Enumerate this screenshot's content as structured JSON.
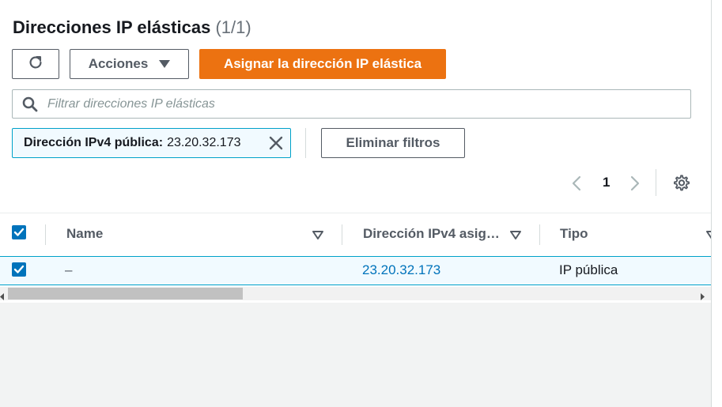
{
  "header": {
    "title": "Direcciones IP elásticas",
    "count": "(1/1)"
  },
  "toolbar": {
    "refresh_icon": "refresh-icon",
    "actions_label": "Acciones",
    "allocate_label": "Asignar la dirección IP elástica"
  },
  "search": {
    "placeholder": "Filtrar direcciones IP elásticas",
    "value": ""
  },
  "filter": {
    "token_key": "Dirección IPv4 pública:",
    "token_value": "23.20.32.173",
    "clear_label": "Eliminar filtros"
  },
  "pagination": {
    "current_page": "1"
  },
  "table": {
    "columns": [
      {
        "label": "Name"
      },
      {
        "label": "Dirección IPv4 asig…"
      },
      {
        "label": "Tipo"
      }
    ],
    "rows": [
      {
        "name": "–",
        "ip": "23.20.32.173",
        "type": "IP pública",
        "selected": true
      }
    ]
  },
  "colors": {
    "primary": "#ec7211",
    "link": "#0073bb",
    "selected_bg": "#f1faff",
    "selected_border": "#00a1c9"
  }
}
